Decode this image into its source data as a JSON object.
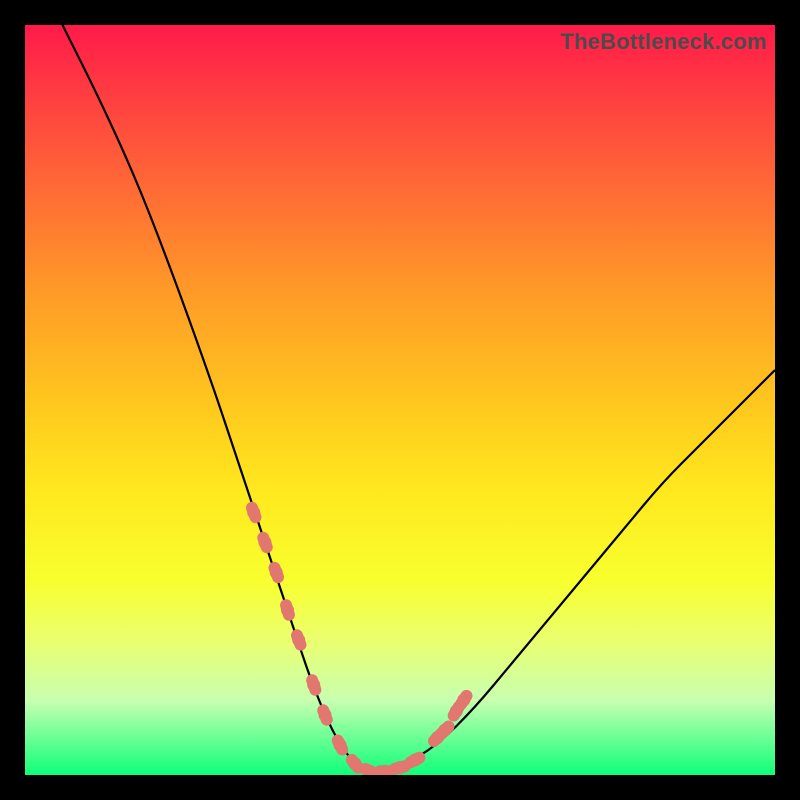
{
  "watermark": "TheBottleneck.com",
  "colors": {
    "background": "#000000",
    "curve": "#000000",
    "marker": "#e2776f",
    "gradient_stops": [
      "#ff1a4a",
      "#ff4040",
      "#ff6b35",
      "#ff9828",
      "#ffc61e",
      "#ffe81e",
      "#f8ff2e",
      "#eaff6e",
      "#c8ffb0",
      "#0eff7a"
    ]
  },
  "chart_data": {
    "type": "line",
    "title": "",
    "xlabel": "",
    "ylabel": "",
    "xlim": [
      0,
      100
    ],
    "ylim": [
      0,
      100
    ],
    "series": [
      {
        "name": "bottleneck-curve",
        "x": [
          5,
          10,
          15,
          20,
          25,
          28,
          30,
          32,
          34,
          36,
          38,
          40,
          42,
          44,
          46,
          48,
          50,
          55,
          60,
          65,
          70,
          75,
          80,
          85,
          90,
          95,
          100
        ],
        "y": [
          100,
          90,
          79,
          66,
          52,
          43,
          37,
          31,
          25,
          19,
          13,
          8,
          4,
          1.5,
          0.5,
          0.5,
          1,
          4,
          9,
          15,
          21,
          27,
          33,
          39,
          44,
          49,
          54
        ]
      }
    ],
    "markers": {
      "name": "highlighted-points",
      "x": [
        30.5,
        32,
        33.5,
        35,
        36.5,
        38.5,
        40,
        42,
        44,
        46,
        48,
        50,
        52,
        55,
        56,
        57.5,
        58.5
      ],
      "y": [
        35,
        31,
        27,
        22,
        18,
        12,
        8,
        4,
        1.5,
        0.5,
        0.5,
        1,
        2,
        5,
        6,
        8.5,
        10
      ]
    }
  }
}
